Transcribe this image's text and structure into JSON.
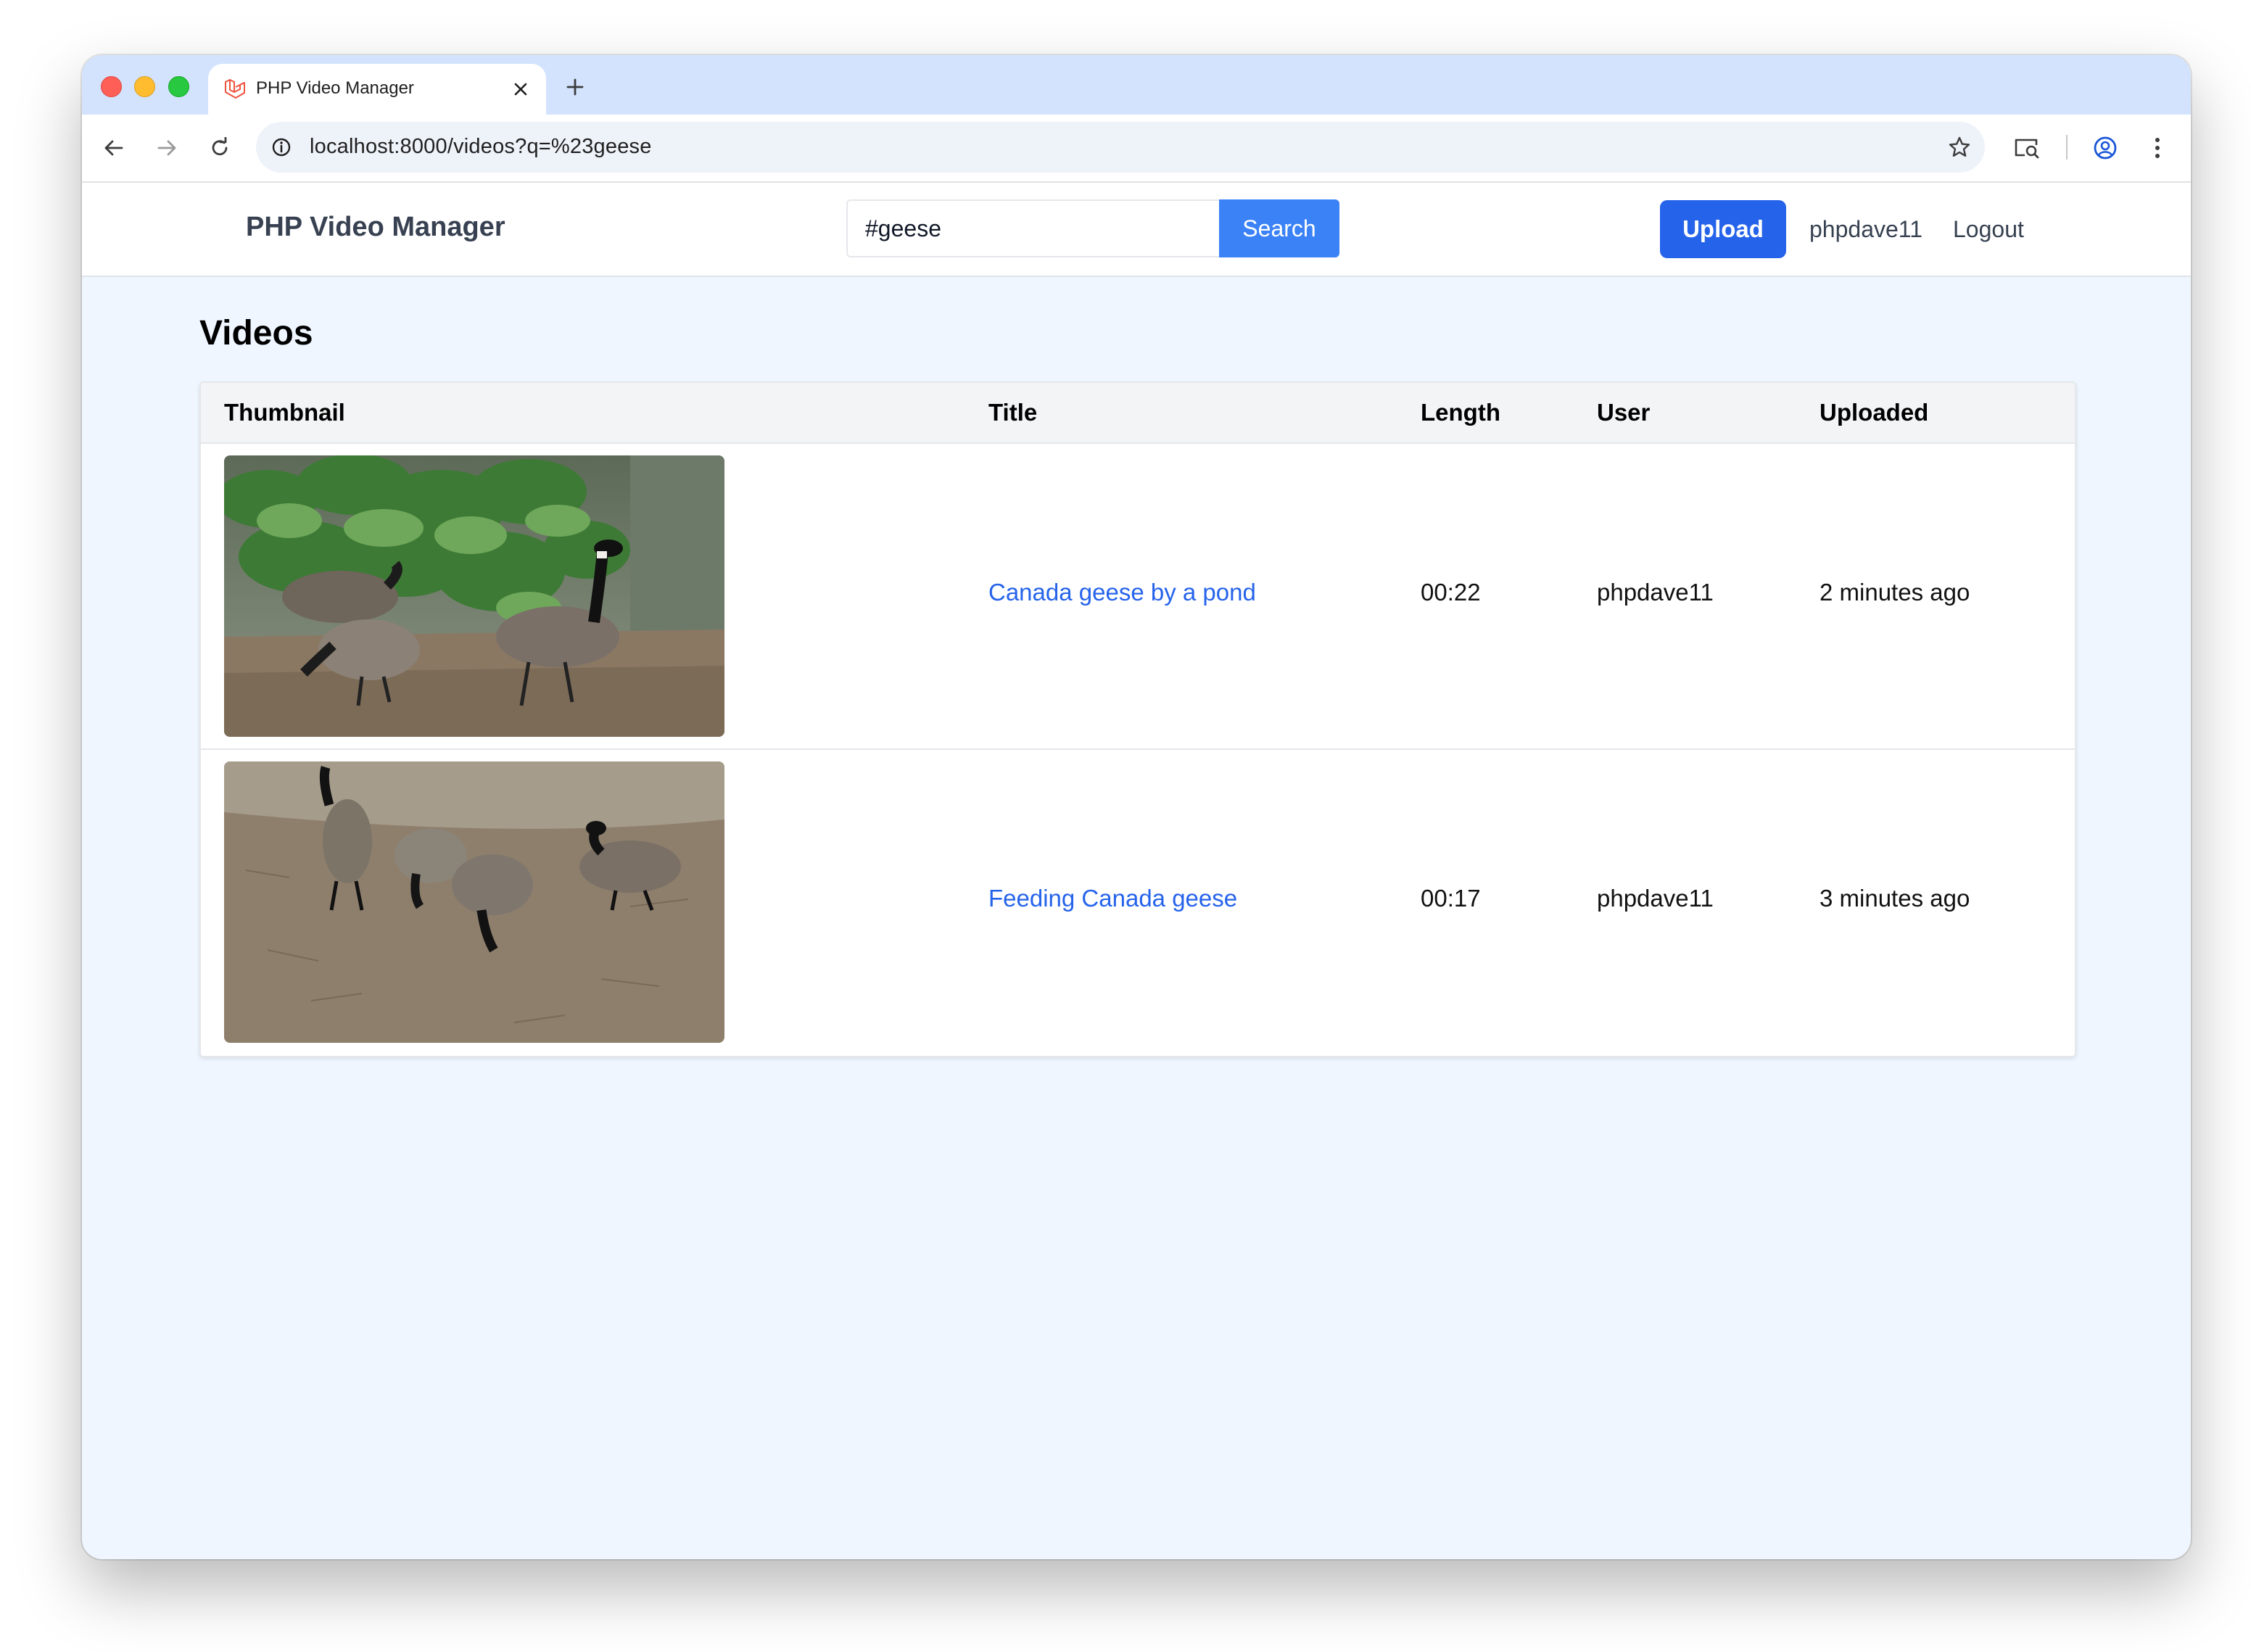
{
  "browser": {
    "tab_title": "PHP Video Manager",
    "url": "localhost:8000/videos?q=%23geese",
    "icons": {
      "back": "arrow-left-icon",
      "forward": "arrow-right-icon",
      "reload": "reload-icon",
      "site_info": "info-circle-icon",
      "bookmark": "star-icon",
      "lens": "search-screen-icon",
      "profile": "profile-icon",
      "menu": "kebab-menu-icon",
      "favicon": "laravel-logo-icon"
    }
  },
  "header": {
    "brand": "PHP Video Manager",
    "search_value": "#geese",
    "search_button": "Search",
    "upload_button": "Upload",
    "username": "phpdave11",
    "logout": "Logout"
  },
  "main": {
    "title": "Videos",
    "columns": [
      "Thumbnail",
      "Title",
      "Length",
      "User",
      "Uploaded"
    ],
    "rows": [
      {
        "title": "Canada geese by a pond",
        "length": "00:22",
        "user": "phpdave11",
        "uploaded": "2 minutes ago"
      },
      {
        "title": "Feeding Canada geese",
        "length": "00:17",
        "user": "phpdave11",
        "uploaded": "3 minutes ago"
      }
    ]
  },
  "colors": {
    "accent": "#2563eb",
    "search_button": "#3b82f6",
    "page_background": "#eff6ff",
    "tab_strip": "#d3e3fd"
  }
}
